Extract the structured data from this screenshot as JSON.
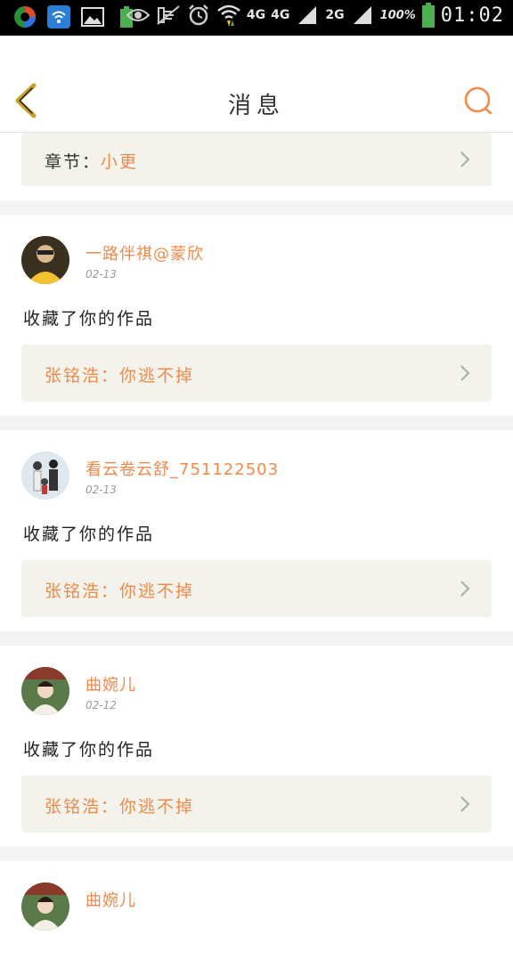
{
  "status_bar": {
    "network1": "4G",
    "network2": "4G",
    "network3": "2G",
    "battery_percent": "100%",
    "battery_small": "100%",
    "time": "01:02"
  },
  "header": {
    "title": "消息"
  },
  "top_partial": {
    "label": "章节：",
    "value": "小更"
  },
  "messages": [
    {
      "user": "一路伴祺@蒙欣",
      "date": "02-13",
      "action": "收藏了你的作品",
      "work_label": "张铭浩：",
      "work_title": "你逃不掉"
    },
    {
      "user": "看云卷云舒_751122503",
      "date": "02-13",
      "action": "收藏了你的作品",
      "work_label": "张铭浩：",
      "work_title": "你逃不掉"
    },
    {
      "user": "曲婉儿",
      "date": "02-12",
      "action": "收藏了你的作品",
      "work_label": "张铭浩：",
      "work_title": "你逃不掉"
    },
    {
      "user": "曲婉儿"
    }
  ],
  "colors": {
    "accent": "#f08a4b",
    "box_bg": "#f3f2eb",
    "back_arrow": "#c9a227"
  }
}
